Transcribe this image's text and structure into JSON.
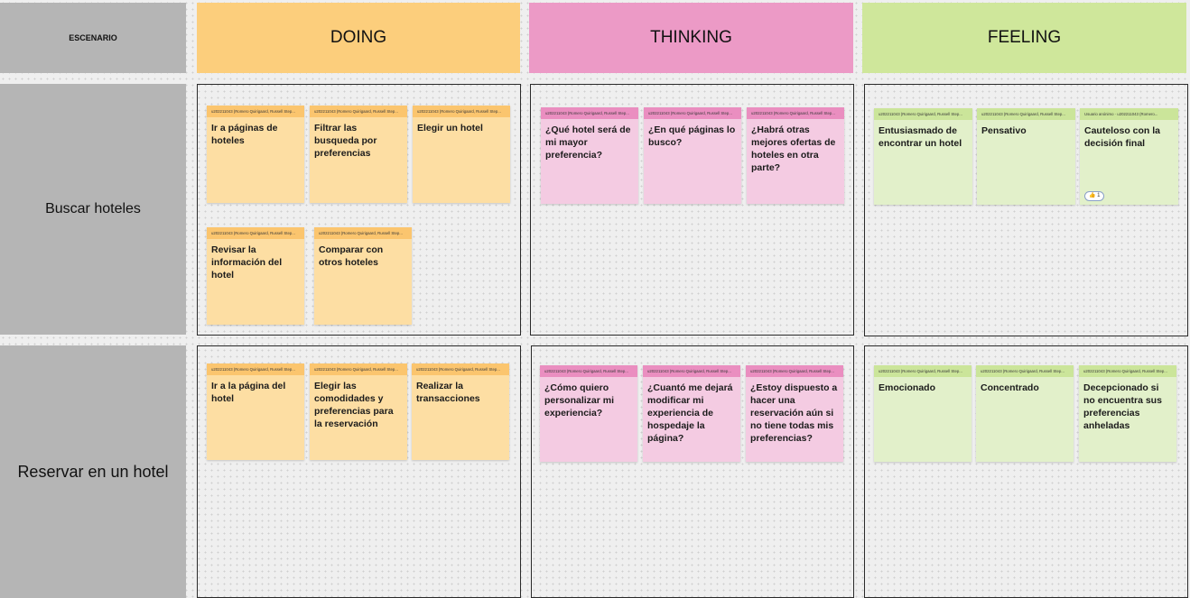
{
  "header": {
    "escenario": "ESCENARIO",
    "doing": "DOING",
    "thinking": "THINKING",
    "feeling": "FEELING"
  },
  "rows": {
    "buscar": "Buscar hoteles",
    "reservar": "Reservar en un hotel"
  },
  "colors": {
    "doing_header": "#fcce7c",
    "thinking_header": "#ec9ac6",
    "feeling_header": "#cfe79b",
    "label_gray": "#b5b5b5"
  },
  "notes": {
    "buscar_doing": [
      {
        "author": "u202211043 (Romero Quirigaard, Russell Step...",
        "text": "Ir a páginas de hoteles"
      },
      {
        "author": "u202211043 (Romero Quirigaard, Russell Step...",
        "text": "Filtrar las busqueda por preferencias"
      },
      {
        "author": "u202211043 (Romero Quirigaard, Russell Step...",
        "text": "Elegir un hotel"
      },
      {
        "author": "u202211043 (Romero Quirigaard, Russell Step...",
        "text": "Revisar la información del hotel"
      },
      {
        "author": "u202211043 (Romero Quirigaard, Russell Step...",
        "text": "Comparar con otros hoteles"
      }
    ],
    "buscar_thinking": [
      {
        "author": "u202211043 (Romero Quirigaard, Russell Step...",
        "text": "¿Qué hotel será de mi mayor preferencia?"
      },
      {
        "author": "u202211043 (Romero Quirigaard, Russell Step...",
        "text": "¿En qué páginas lo busco?"
      },
      {
        "author": "u202211043 (Romero Quirigaard, Russell Step...",
        "text": "¿Habrá otras mejores ofertas de hoteles en otra parte?"
      }
    ],
    "buscar_feeling": [
      {
        "author": "u202211043 (Romero Quirigaard, Russell Step...",
        "text": "Entusiasmado de encontrar un hotel"
      },
      {
        "author": "u202211043 (Romero Quirigaard, Russell Step...",
        "text": "Pensativo"
      },
      {
        "author": "Usuario anónimo · u202211043 (Romero...",
        "text": "Cauteloso con la decisión final",
        "reaction": "👍 1"
      }
    ],
    "reservar_doing": [
      {
        "author": "u202211043 (Romero Quirigaard, Russell Step...",
        "text": "Ir a la página del hotel"
      },
      {
        "author": "u202211043 (Romero Quirigaard, Russell Step...",
        "text": "Elegir las comodidades y preferencias para la reservación"
      },
      {
        "author": "u202211043 (Romero Quirigaard, Russell Step...",
        "text": "Realizar la transacciones"
      }
    ],
    "reservar_thinking": [
      {
        "author": "u202211043 (Romero Quirigaard, Russell Step...",
        "text": "¿Cómo quiero personalizar mi experiencia?"
      },
      {
        "author": "u202211043 (Romero Quirigaard, Russell Step...",
        "text": "¿Cuantó me dejará modificar mi experiencia de hospedaje la página?"
      },
      {
        "author": "u202211043 (Romero Quirigaard, Russell Step...",
        "text": "¿Estoy dispuesto a hacer una reservación aún si no tiene todas mis preferencias?"
      }
    ],
    "reservar_feeling": [
      {
        "author": "u202211043 (Romero Quirigaard, Russell Step...",
        "text": "Emocionado"
      },
      {
        "author": "u202211043 (Romero Quirigaard, Russell Step...",
        "text": "Concentrado"
      },
      {
        "author": "u202211043 (Romero Quirigaard, Russell Step...",
        "text": "Decepcionado si no encuentra sus preferencias anheladas"
      }
    ]
  }
}
